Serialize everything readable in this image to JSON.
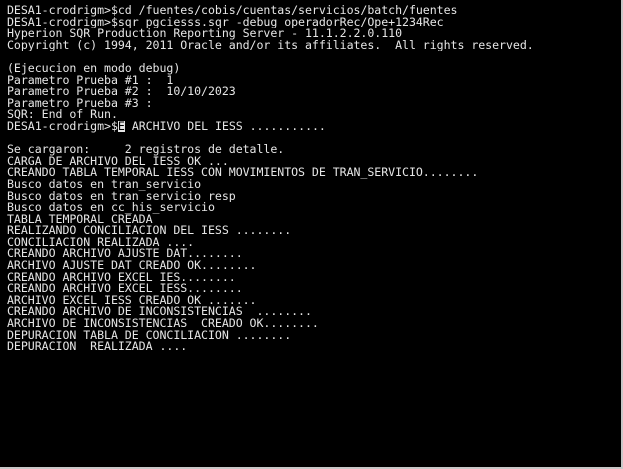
{
  "terminal": {
    "colors": {
      "background": "#000000",
      "foreground": "#e6e6e6",
      "frame": "#c8c8c8"
    },
    "cursor_glyph": "E",
    "lines": [
      "DESA1-crodrigm>$cd /fuentes/cobis/cuentas/servicios/batch/fuentes",
      "DESA1-crodrigm>$sqr pgciesss.sqr -debug operadorRec/Ope+1234Rec",
      "Hyperion SQR Production Reporting Server - 11.1.2.2.0.110",
      "Copyright (c) 1994, 2011 Oracle and/or its affiliates.  All rights reserved.",
      "",
      "(Ejecucion en modo debug)",
      "Parametro Prueba #1 :  1",
      "Parametro Prueba #2 :  10/10/2023",
      "Parametro Prueba #3 :",
      "SQR: End of Run.",
      "DESA1-crodrigm>$",
      "",
      "Se cargaron:     2 registros de detalle.",
      "CARGA DE ARCHIVO DEL IESS OK ...",
      "CREANDO TABLA TEMPORAL IESS CON MOVIMIENTOS DE TRAN_SERVICIO........",
      "Busco datos en tran_servicio",
      "Busco datos en tran_servicio_resp",
      "Busco datos en cc_his_servicio",
      "TABLA TEMPORAL CREADA",
      "REALIZANDO CONCILIACION DEL IESS ........",
      "CONCILIACION REALIZADA ....",
      "CREANDO ARCHIVO AJUSTE DAT........",
      "ARCHIVO AJUSTE DAT CREADO OK........",
      "CREANDO ARCHIVO EXCEL IES........",
      "CREANDO ARCHIVO EXCEL IESS........",
      "ARCHIVO EXCEL IESS CREADO OK .......",
      "CREANDO ARCHIVO DE INCONSISTENCIAS  ........",
      "ARCHIVO DE INCONSISTENCIAS  CREADO OK........",
      "DEPURACION TABLA DE CONCILIACION ........",
      "DEPURACION  REALIZADA ...."
    ],
    "line_after_cursor": " ARCHIVO DEL IESS ..........."
  }
}
